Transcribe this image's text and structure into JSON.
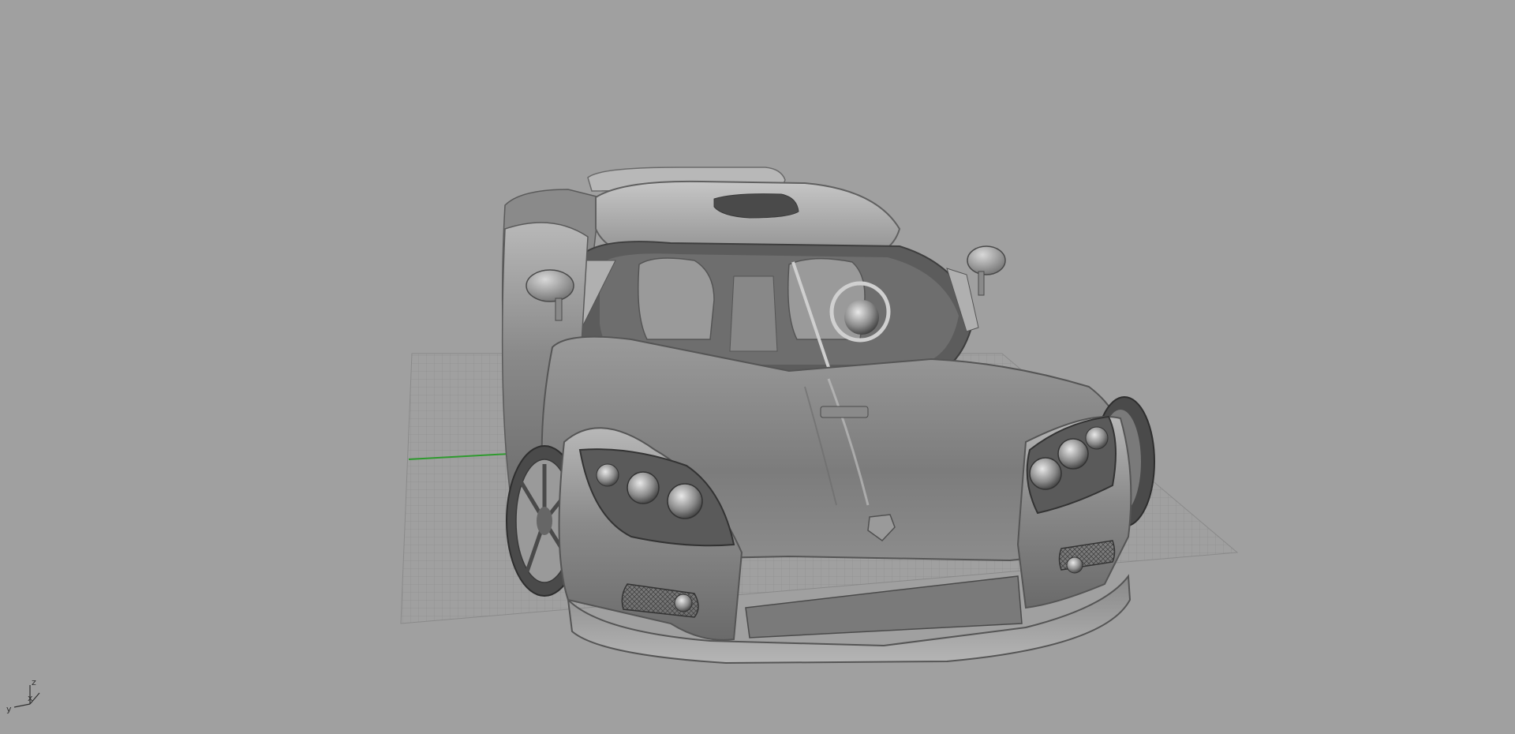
{
  "viewport": {
    "background_color": "#a0a0a0",
    "display_mode": "shaded",
    "grid_visible": true,
    "grid_color": "#8c8c8c",
    "x_axis_color": "#2e9a2e"
  },
  "axis_gizmo": {
    "z_label": "z",
    "x_label": "x",
    "y_label": "y"
  },
  "model": {
    "icon": "sports-car-model"
  }
}
